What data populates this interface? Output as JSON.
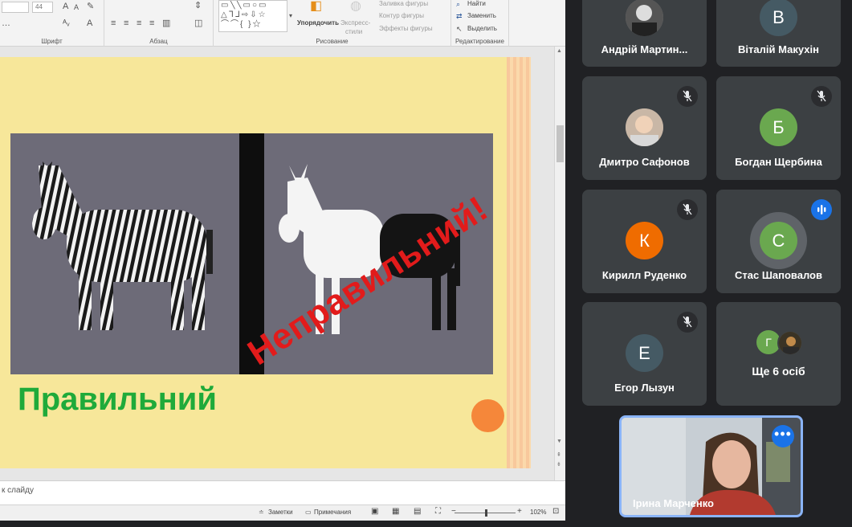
{
  "ribbon": {
    "font_size_value": "44",
    "groups": {
      "font": "Шрифт",
      "paragraph": "Абзац",
      "drawing": "Рисование",
      "editing": "Редактирование"
    },
    "arrange_label": "Упорядочить",
    "express_styles_label_1": "Экспресс-",
    "express_styles_label_2": "стили",
    "shape_fill": "Заливка фигуры",
    "shape_outline": "Контур фигуры",
    "shape_effects": "Эффекты фигуры",
    "find": "Найти",
    "replace": "Заменить",
    "select": "Выделить"
  },
  "slide": {
    "wrong_text": "Неправильний!",
    "right_text": "Правильний",
    "colors": {
      "background": "#f7e79a",
      "wrong": "#e21b1b",
      "right": "#1faa3a",
      "dot": "#f5873a"
    }
  },
  "notes": {
    "placeholder": "Заметки к слайду"
  },
  "notes_visible": "к слайду",
  "statusbar": {
    "notes_btn": "Заметки",
    "comments_btn": "Примечания",
    "zoom_minus": "−",
    "zoom_plus": "+",
    "zoom_level": "102%"
  },
  "participants": [
    {
      "name": "Андрій Мартин...",
      "initial": "",
      "avatar_type": "photo",
      "muted": false,
      "tile": 0
    },
    {
      "name": "Віталій Макухін",
      "initial": "В",
      "avatar_color": "#455a64",
      "muted": false,
      "tile": 1
    },
    {
      "name": "Дмитро Сафонов",
      "initial": "",
      "avatar_type": "photo",
      "muted": true,
      "tile": 2
    },
    {
      "name": "Богдан Щербина",
      "initial": "Б",
      "avatar_color": "#6aa84f",
      "muted": true,
      "tile": 3
    },
    {
      "name": "Кирилл Руденко",
      "initial": "К",
      "avatar_color": "#ef6c00",
      "muted": true,
      "tile": 4
    },
    {
      "name": "Стас Шаповалов",
      "initial": "С",
      "avatar_color": "#6aa84f",
      "muted": false,
      "speaking": true,
      "tile": 5
    },
    {
      "name": "Егор Лызун",
      "initial": "Е",
      "avatar_color": "#455a64",
      "muted": true,
      "tile": 6
    }
  ],
  "more_tile": {
    "label": "Ще 6 осіб",
    "initial": "Г"
  },
  "self_view": {
    "name": "Ірина Марченко"
  },
  "colors": {
    "meet_bg": "#202124",
    "tile_bg": "#3c4043",
    "accent": "#1a73e8",
    "self_border": "#8ab4f8"
  }
}
